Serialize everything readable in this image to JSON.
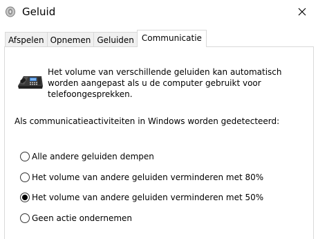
{
  "window": {
    "title": "Geluid",
    "icon": "speaker-icon",
    "close_icon": "close-icon"
  },
  "tabs": [
    {
      "label": "Afspelen",
      "active": false
    },
    {
      "label": "Opnemen",
      "active": false
    },
    {
      "label": "Geluiden",
      "active": false
    },
    {
      "label": "Communicatie",
      "active": true
    }
  ],
  "communication": {
    "icon": "telephone-icon",
    "intro_lines": [
      "Het volume van verschillende geluiden kan automatisch",
      "worden aangepast als u de computer gebruikt voor",
      "telefoongesprekken."
    ],
    "detect_label": "Als communicatieactiviteiten in Windows worden gedetecteerd:",
    "options": [
      {
        "label": "Alle andere geluiden dempen",
        "selected": false
      },
      {
        "label": "Het volume van andere geluiden verminderen met 80%",
        "selected": false
      },
      {
        "label": "Het volume van andere geluiden verminderen met 50%",
        "selected": true
      },
      {
        "label": "Geen actie ondernemen",
        "selected": false
      }
    ]
  }
}
